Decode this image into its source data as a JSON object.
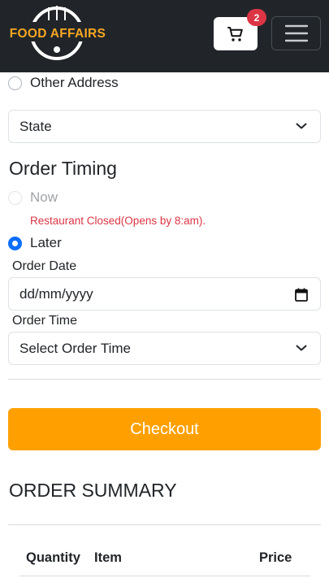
{
  "header": {
    "logo_text": "FOOD AFFAIRS",
    "cart_count": "2",
    "brand_color": "#f5a623",
    "navbar_color": "#212529"
  },
  "address": {
    "other_address_label": "Other Address",
    "state_select_value": "State"
  },
  "order_timing": {
    "heading": "Order Timing",
    "now_label": "Now",
    "closed_message": "Restaurant Closed(Opens by 8:am).",
    "later_label": "Later",
    "order_date_label": "Order Date",
    "order_date_placeholder": "dd/mm/yyyy",
    "order_time_label": "Order Time",
    "order_time_value": "Select Order Time"
  },
  "checkout": {
    "label": "Checkout",
    "color": "#ffa000"
  },
  "summary": {
    "title": "ORDER SUMMARY",
    "columns": [
      "Quantity",
      "Item",
      "Price"
    ]
  },
  "icons": {
    "cart": "cart-icon",
    "menu": "hamburger-menu-icon",
    "chevron": "chevron-down-icon",
    "calendar": "calendar-icon"
  }
}
